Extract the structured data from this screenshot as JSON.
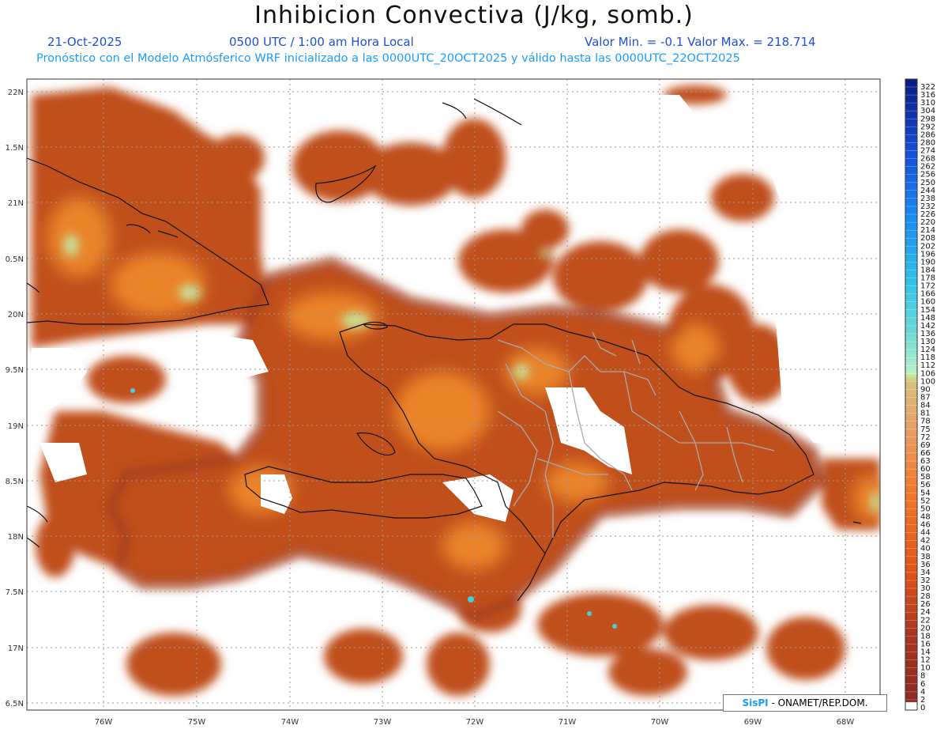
{
  "header": {
    "title": "Inhibicion Convectiva (J/kg, somb.)",
    "date": "21-Oct-2025",
    "time": "0500 UTC / 1:00 am Hora Local",
    "minmax": "Valor Min. = -0.1  Valor Max. = 218.714",
    "model_line": "Pronóstico con el Modelo Atmósferico WRF inicializado a las 0000UTC_20OCT2025 y válido hasta las  0000UTC_22OCT2025"
  },
  "axes": {
    "lat_labels": [
      "22N",
      "1.5N",
      "21N",
      "0.5N",
      "20N",
      "9.5N",
      "19N",
      "8.5N",
      "18N",
      "7.5N",
      "17N",
      "6.5N"
    ],
    "lon_labels": [
      "76W",
      "75W",
      "74W",
      "73W",
      "72W",
      "71W",
      "70W",
      "69W",
      "68W"
    ]
  },
  "colorbar": {
    "labels": [
      "322",
      "316",
      "310",
      "304",
      "298",
      "292",
      "286",
      "280",
      "274",
      "268",
      "262",
      "256",
      "250",
      "244",
      "238",
      "232",
      "226",
      "220",
      "214",
      "208",
      "202",
      "196",
      "190",
      "184",
      "178",
      "172",
      "166",
      "160",
      "154",
      "148",
      "142",
      "136",
      "130",
      "124",
      "118",
      "112",
      "106",
      "100",
      "90",
      "87",
      "84",
      "81",
      "78",
      "75",
      "72",
      "69",
      "66",
      "63",
      "60",
      "58",
      "56",
      "54",
      "52",
      "50",
      "48",
      "46",
      "44",
      "42",
      "40",
      "38",
      "36",
      "34",
      "32",
      "30",
      "28",
      "26",
      "24",
      "22",
      "20",
      "18",
      "16",
      "14",
      "12",
      "10",
      "8",
      "6",
      "4",
      "2",
      "0"
    ],
    "colors": {
      "low": "#8b2a22",
      "mid": "#e86a1c",
      "high_warm": "#d8c07a",
      "pale": "#c8f0c0",
      "cyan": "#3cd0d8",
      "blue": "#1a80f0",
      "navy": "#0a1a80"
    }
  },
  "credit": {
    "logo": "SisPI",
    "text": " - ONAMET/REP.DOM."
  },
  "map_colors": {
    "field": "#c0501e",
    "field_dark": "#93331f",
    "hotspot": "#f08a2c",
    "pale": "#bff0b0",
    "border": "#111111",
    "provinces": "#aaaaaa"
  }
}
